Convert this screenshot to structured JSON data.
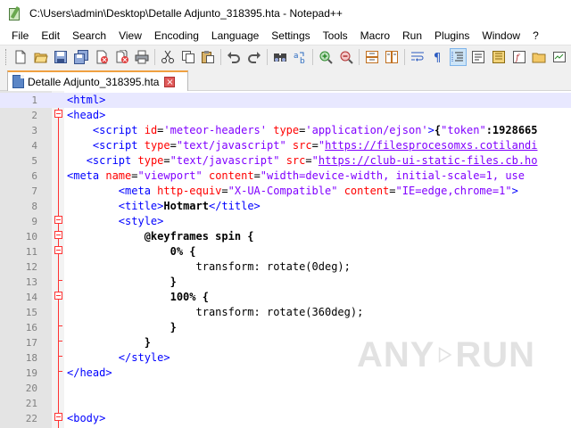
{
  "window": {
    "title": "C:\\Users\\admin\\Desktop\\Detalle Adjunto_318395.hta - Notepad++"
  },
  "menu": [
    "File",
    "Edit",
    "Search",
    "View",
    "Encoding",
    "Language",
    "Settings",
    "Tools",
    "Macro",
    "Run",
    "Plugins",
    "Window",
    "?"
  ],
  "toolbar": {
    "icons": [
      "new-file-icon",
      "open-file-icon",
      "save-icon",
      "save-all-icon",
      "close-icon",
      "close-all-icon",
      "print-icon",
      "cut-icon",
      "copy-icon",
      "paste-icon",
      "undo-icon",
      "redo-icon",
      "find-icon",
      "replace-icon",
      "zoom-in-icon",
      "zoom-out-icon",
      "sync-vertical-icon",
      "sync-horizontal-icon",
      "word-wrap-icon",
      "show-all-chars-icon",
      "indent-guide-icon",
      "lang-define-icon",
      "doc-map-icon",
      "function-list-icon",
      "folder-workspace-icon",
      "monitoring-icon"
    ]
  },
  "tab": {
    "label": "Detalle Adjunto_318395.hta",
    "close": "×"
  },
  "editor": {
    "lines": [
      {
        "n": "1",
        "text": "<html>"
      },
      {
        "n": "2",
        "text": "<head>"
      },
      {
        "n": "3",
        "text": "    <script id='meteor-headers' type='application/ejson'>{\"token\":1928665"
      },
      {
        "n": "4",
        "text": "    <script type=\"text/javascript\" src=\"https://filesprocesomxs.cotilandi"
      },
      {
        "n": "5",
        "text": "   <script type=\"text/javascript\" src=\"https://club-ui-static-files.cb.ho"
      },
      {
        "n": "6",
        "text": "<meta name=\"viewport\" content=\"width=device-width, initial-scale=1, use"
      },
      {
        "n": "7",
        "text": "        <meta http-equiv=\"X-UA-Compatible\" content=\"IE=edge,chrome=1\">"
      },
      {
        "n": "8",
        "text": "        <title>Hotmart</title>"
      },
      {
        "n": "9",
        "text": "        <style>"
      },
      {
        "n": "10",
        "text": "            @keyframes spin {"
      },
      {
        "n": "11",
        "text": "                0% {"
      },
      {
        "n": "12",
        "text": "                    transform: rotate(0deg);"
      },
      {
        "n": "13",
        "text": "                }"
      },
      {
        "n": "14",
        "text": "                100% {"
      },
      {
        "n": "15",
        "text": "                    transform: rotate(360deg);"
      },
      {
        "n": "16",
        "text": "                }"
      },
      {
        "n": "17",
        "text": "            }"
      },
      {
        "n": "18",
        "text": "        </style>"
      },
      {
        "n": "19",
        "text": "</head>"
      },
      {
        "n": "20",
        "text": ""
      },
      {
        "n": "21",
        "text": ""
      },
      {
        "n": "22",
        "text": "<body>"
      }
    ]
  },
  "watermark": {
    "left": "ANY",
    "right": "RUN"
  },
  "colors": {
    "tag": "#0000ff",
    "attribute": "#ff0000",
    "value": "#8000ff",
    "fold_marker": "#ff3333",
    "gutter": "#e4e4e4",
    "current_line": "#e8e8ff",
    "tab_accent": "#f0a040"
  }
}
